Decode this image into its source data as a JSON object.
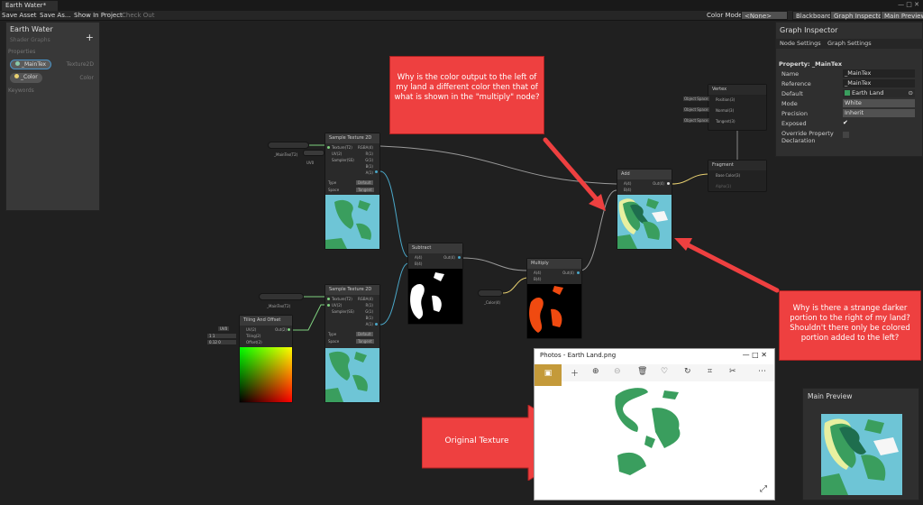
{
  "window": {
    "tab_title": "Earth Water*",
    "controls": "— □ ✕"
  },
  "toolbar": {
    "save_asset": "Save Asset",
    "save_as": "Save As...",
    "show_in_project": "Show In Project",
    "check_out": "Check Out"
  },
  "toolbar_right": {
    "color_mode_label": "Color Mode",
    "color_mode_value": "<None>",
    "blackboard": "Blackboard",
    "graph_inspector": "Graph Inspector",
    "main_preview": "Main Preview"
  },
  "blackboard": {
    "title": "Earth Water",
    "subtitle": "Shader Graphs",
    "add": "+",
    "properties_label": "Properties",
    "properties": [
      {
        "name": "_MainTex",
        "type": "Texture2D"
      },
      {
        "name": "_Color",
        "type": "Color"
      }
    ],
    "keywords_label": "Keywords"
  },
  "inspector": {
    "title": "Graph Inspector",
    "tab_node": "Node Settings",
    "tab_graph": "Graph Settings",
    "property_heading": "Property: _MainTex",
    "rows": [
      {
        "label": "Name",
        "value": "_MainTex"
      },
      {
        "label": "Reference",
        "value": "_MainTex"
      },
      {
        "label": "Default",
        "value": "Earth Land"
      },
      {
        "label": "Mode",
        "value": "White"
      },
      {
        "label": "Precision",
        "value": "Inherit"
      },
      {
        "label": "Exposed",
        "value": "✔"
      },
      {
        "label": "Override Property Declaration",
        "value": ""
      }
    ]
  },
  "nodes": {
    "sample1": {
      "title": "Sample Texture 2D",
      "in": [
        "Texture(T2)",
        "UV(2)",
        "Sampler(SS)"
      ],
      "out": [
        "RGBA(4)",
        "R(1)",
        "G(1)",
        "B(1)",
        "A(1)"
      ],
      "type_label": "Type",
      "type_value": "Default",
      "space_label": "Space",
      "space_value": "Tangent"
    },
    "sample2": {
      "title": "Sample Texture 2D",
      "in": [
        "Texture(T2)",
        "UV(2)",
        "Sampler(SS)"
      ],
      "out": [
        "RGBA(4)",
        "R(1)",
        "G(1)",
        "B(1)",
        "A(1)"
      ],
      "type_label": "Type",
      "type_value": "Default",
      "space_label": "Space",
      "space_value": "Tangent"
    },
    "tiling": {
      "title": "Tiling And Offset",
      "in": [
        "UV(2)",
        "Tiling(2)",
        "Offset(2)"
      ],
      "out": [
        "Out(2)"
      ],
      "uv_value": "UV0",
      "tiling_x": "1",
      "tiling_y": "1",
      "offset_x": "0.12",
      "offset_y": "0"
    },
    "subtract": {
      "title": "Subtract",
      "in": [
        "A(4)",
        "B(4)"
      ],
      "out": [
        "Out(4)"
      ]
    },
    "multiply": {
      "title": "Multiply",
      "in": [
        "A(4)",
        "B(4)"
      ],
      "out": [
        "Out(4)"
      ]
    },
    "add": {
      "title": "Add",
      "in": [
        "A(4)",
        "B(4)"
      ],
      "out": [
        "Out(4)"
      ]
    },
    "vertex": {
      "title": "Vertex",
      "rows": [
        "Position(3)",
        "Normal(3)",
        "Tangent(3)"
      ],
      "space": "Object Space"
    },
    "fragment": {
      "title": "Fragment",
      "rows": [
        "Base Color(3)",
        "Alpha(1)"
      ]
    }
  },
  "prop_nodes": {
    "maintex1": "_MainTex(T2)",
    "uv1": "UV0",
    "maintex2": "_MainTex(T2)",
    "color": "_Color(4)"
  },
  "annotations": {
    "a1": "Why is the color output to the left of my land a different color then that of what is shown in the \"multiply\" node?",
    "a2": "Why is there a strange darker portion to the right of my land? Shouldn't there only be colored portion added to the left?",
    "a3": "Original Texture"
  },
  "photos": {
    "title": "Photos - Earth Land.png",
    "controls": "—   □   ✕"
  },
  "preview": {
    "title": "Main Preview"
  },
  "colors": {
    "annotation_red": "#ee4040",
    "ocean": "#6ec5d6",
    "land": "#3a9e5e",
    "orange": "#f04a10"
  }
}
